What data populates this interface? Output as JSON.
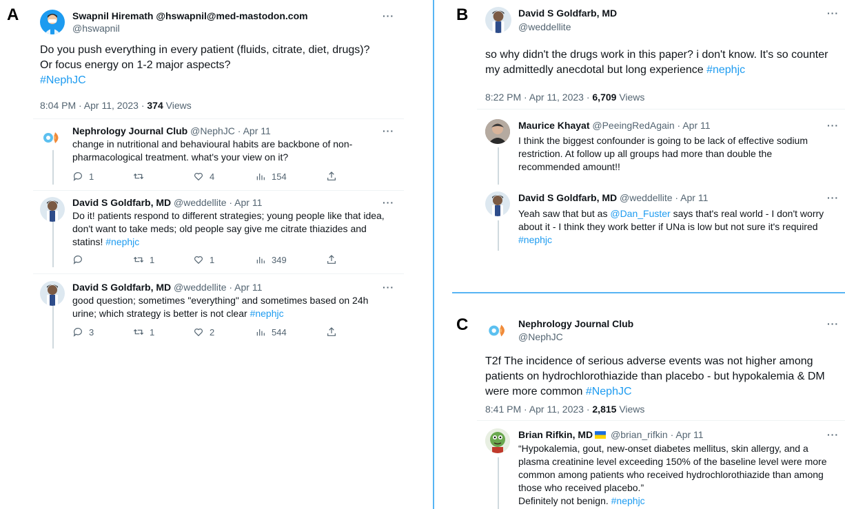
{
  "panels": {
    "a": "A",
    "b": "B",
    "c": "C"
  },
  "tweetA": {
    "name": "Swapnil Hiremath @hswapnil@med-mastodon.com",
    "handle": "@hswapnil",
    "line1": "Do you push everything in every patient (fluids, citrate, diet, drugs)?",
    "line2": "Or focus energy on 1-2 major aspects?",
    "hashtag": "#NephJC",
    "time": "8:04 PM · Apr 11, 2023 · ",
    "views_count": "374",
    "views_label": " Views",
    "more": "···"
  },
  "repliesA": [
    {
      "name": "Nephrology Journal Club",
      "meta": " @NephJC · Apr 11",
      "lines": [
        "change in nutritional and behavioural habits are backbone of non-",
        "pharmacological treatment. what's your view on it?"
      ],
      "hashtag": "",
      "reply": "1",
      "retweet": "",
      "like": "4",
      "views": "154"
    },
    {
      "name": "David S Goldfarb, MD",
      "meta": " @weddellite · Apr 11",
      "lines": [
        "Do it! patients respond to different strategies; young people like that idea,",
        "don't want to take meds; old people say give me citrate thiazides and",
        "statins! "
      ],
      "hashtag": "#nephjc",
      "reply": "",
      "retweet": "1",
      "like": "1",
      "views": "349"
    },
    {
      "name": "David S Goldfarb, MD",
      "meta": " @weddellite · Apr 11",
      "lines": [
        "good question; sometimes \"everything\" and sometimes based on 24h",
        "urine; which strategy is better is not clear "
      ],
      "hashtag": "#nephjc",
      "reply": "3",
      "retweet": "1",
      "like": "2",
      "views": "544"
    }
  ],
  "tweetB": {
    "name": "David S Goldfarb, MD",
    "handle": "@weddellite",
    "line1": "so why didn't the drugs work in this paper? i don't know. It's so counter",
    "line2": "my admittedly anecdotal but long experience ",
    "hashtag": "#nephjc",
    "time": "8:22 PM · Apr 11, 2023 · ",
    "views_count": "6,709",
    "views_label": " Views"
  },
  "repliesB": [
    {
      "name": "Maurice Khayat",
      "meta": " @PeeingRedAgain · Apr 11",
      "lines": [
        "I think the biggest confounder is going to be lack of effective sodium",
        "restriction.  At follow up all groups had more than double the",
        "recommended amount!!"
      ]
    },
    {
      "name": "David S Goldfarb, MD",
      "meta": " @weddellite · Apr 11",
      "line1a": "Yeah saw that but as ",
      "mention": "@Dan_Fuster",
      "line1b": " says that's real world - I don't worry",
      "line2": "about it - I think they work better if UNa is low but not sure it's required",
      "hashtag": "#nephjc"
    }
  ],
  "tweetC": {
    "name": "Nephrology Journal Club",
    "handle": "@NephJC",
    "line1": "T2f The incidence of serious adverse events was not higher among",
    "line2": "patients on hydrochlorothiazide than placebo - but hypokalemia & DM",
    "line3": "were more common ",
    "hashtag": "#NephJC",
    "time": "8:41 PM · Apr 11, 2023 · ",
    "views_count": "2,815",
    "views_label": " Views"
  },
  "replyC": {
    "name": "Brian Rifkin, MD",
    "meta": " @brian_rifkin · Apr 11",
    "lines": [
      "“Hypokalemia, gout, new-onset diabetes mellitus, skin allergy, and a",
      "plasma creatinine level exceeding 150% of the baseline level were more",
      "common among patients who received hydrochlorothiazide than among",
      "those who received placebo.”",
      "Definitely not benign. "
    ],
    "hashtag": "#nephjc"
  },
  "colors": {
    "accent": "#1d9bf0",
    "text": "#0f1419",
    "muted": "#536471"
  },
  "icons": [
    "reply-icon",
    "retweet-icon",
    "like-icon",
    "views-icon",
    "share-icon",
    "more-icon",
    "ukraine-flag-icon"
  ]
}
